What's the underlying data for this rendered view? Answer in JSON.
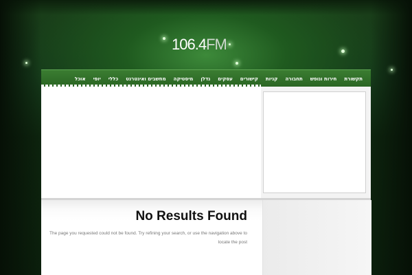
{
  "logo": {
    "number": "106.4",
    "fm": "FM"
  },
  "nav": {
    "items": [
      "תקשורת",
      "חירות ונופש",
      "תחבורה",
      "קניות",
      "קישורים",
      "עסקים",
      "נדלן",
      "מיסטיקה",
      "מחשבים ואינטרנט",
      "כללי",
      "יופי",
      "אוכל"
    ]
  },
  "content": {
    "title": "No Results Found",
    "message_line1": "The page you requested could not be found. Try refining your search, or use the navigation above to",
    "message_line2": "locate the post"
  },
  "colors": {
    "nav": "#2f6e28",
    "background": "#0f2a0f",
    "title": "#111111"
  }
}
